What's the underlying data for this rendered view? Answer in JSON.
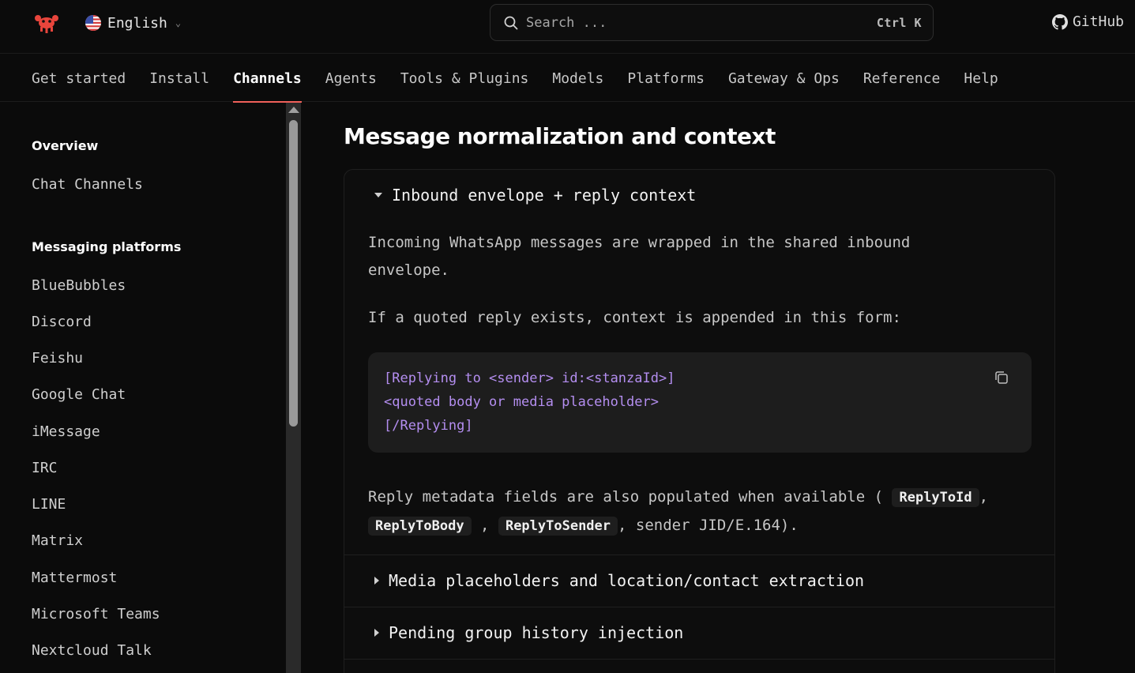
{
  "header": {
    "language": "English",
    "search_placeholder": "Search ...",
    "search_shortcut": "Ctrl K",
    "github_label": "GitHub"
  },
  "nav": {
    "tabs": [
      {
        "label": "Get started"
      },
      {
        "label": "Install"
      },
      {
        "label": "Channels",
        "active": true
      },
      {
        "label": "Agents"
      },
      {
        "label": "Tools & Plugins"
      },
      {
        "label": "Models"
      },
      {
        "label": "Platforms"
      },
      {
        "label": "Gateway & Ops"
      },
      {
        "label": "Reference"
      },
      {
        "label": "Help"
      }
    ]
  },
  "sidebar": {
    "section1_title": "Overview",
    "section1_items": [
      "Chat Channels"
    ],
    "section2_title": "Messaging platforms",
    "section2_items": [
      "BlueBubbles",
      "Discord",
      "Feishu",
      "Google Chat",
      "iMessage",
      "IRC",
      "LINE",
      "Matrix",
      "Mattermost",
      "Microsoft Teams",
      "Nextcloud Talk"
    ]
  },
  "main": {
    "title": "Message normalization and context",
    "accordion": {
      "open_title": "Inbound envelope + reply context",
      "para1_line1": "Incoming WhatsApp messages are wrapped in the shared inbound",
      "para1_line2": "envelope.",
      "para2": "If a quoted reply exists, context is appended in this form:",
      "code_lines": [
        "[Replying to <sender> id:<stanzaId>]",
        "<quoted body or media placeholder>",
        "[/Replying]"
      ],
      "para3_text1": "Reply metadata fields are also populated when available (",
      "para3_code1": "ReplyToId",
      "para3_comma1": ",",
      "para3_code2": "ReplyToBody",
      "para3_comma2": ",",
      "para3_code3": "ReplyToSender",
      "para3_text2": ", sender JID/E.164).",
      "collapsed_titles": [
        "Media placeholders and location/contact extraction",
        "Pending group history injection"
      ]
    }
  },
  "colors": {
    "accent": "#f0605a",
    "code_text": "#b48ef0",
    "background": "#0b0b0b"
  }
}
